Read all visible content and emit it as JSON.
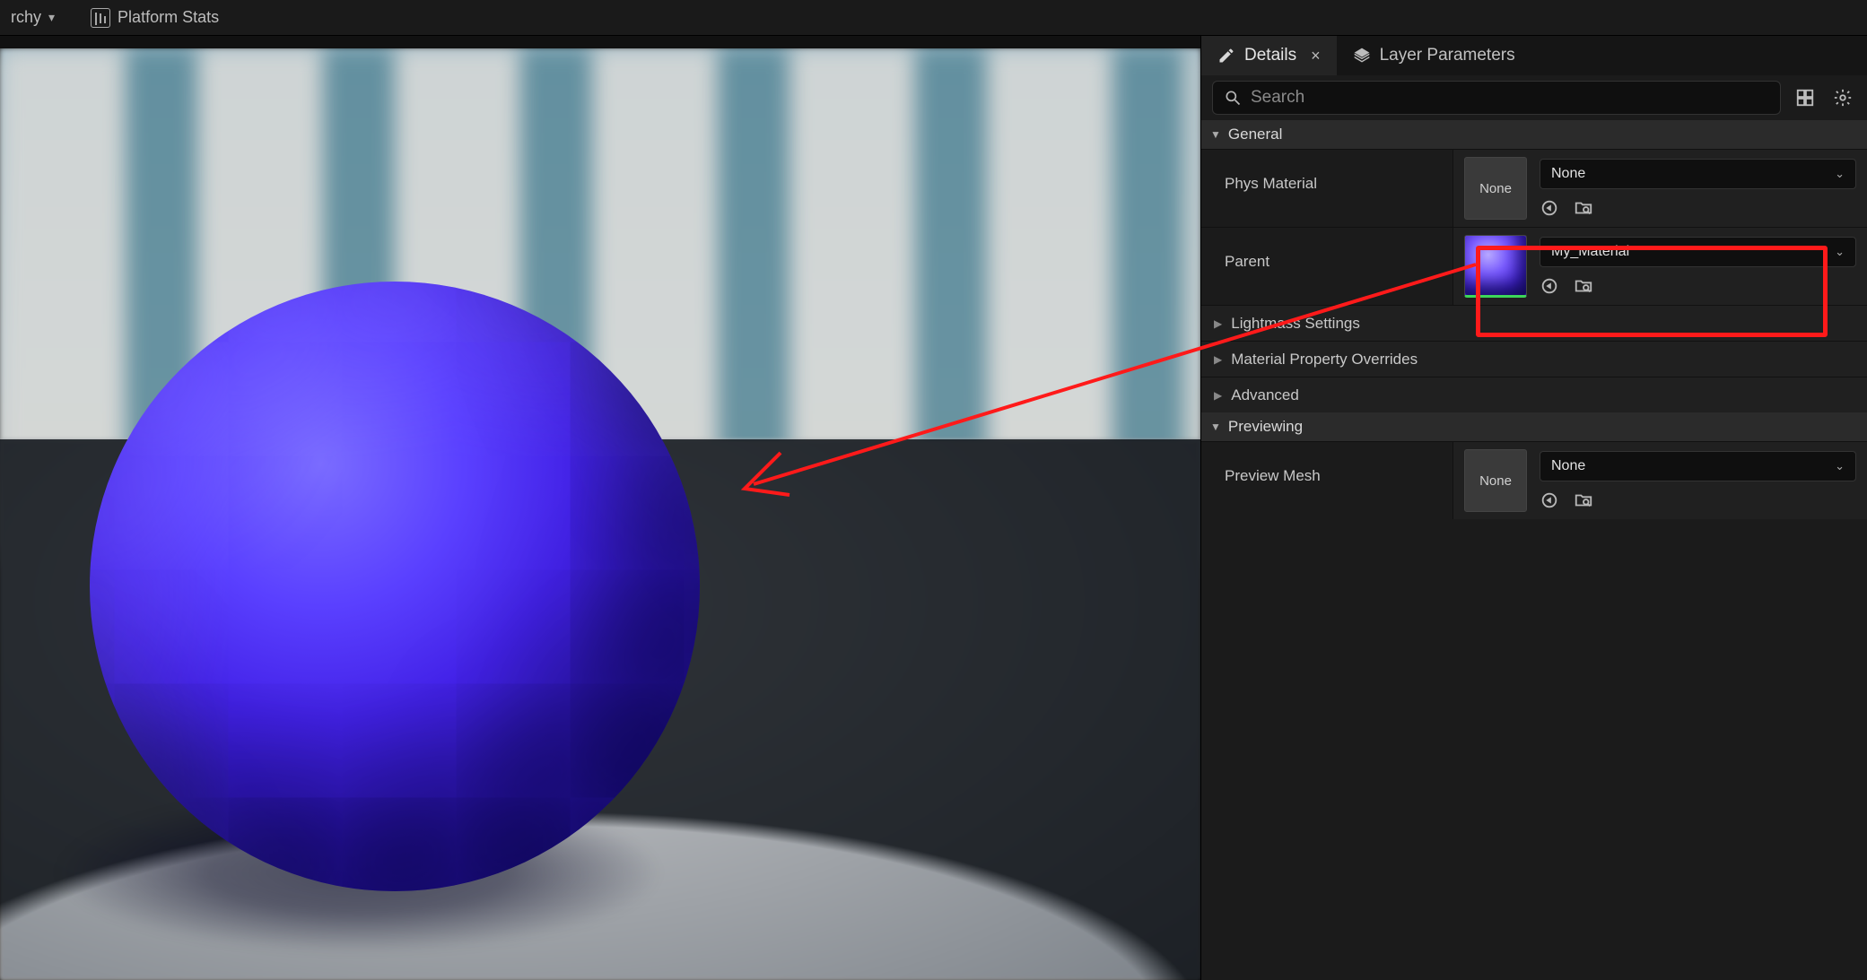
{
  "topstrip": {
    "hierarchy_fragment": "rchy",
    "platform_stats": "Platform Stats"
  },
  "tabs": {
    "details": "Details",
    "layer_params": "Layer Parameters"
  },
  "search": {
    "placeholder": "Search"
  },
  "sections": {
    "general": "General",
    "lightmass": "Lightmass Settings",
    "overrides": "Material Property Overrides",
    "advanced": "Advanced",
    "previewing": "Previewing"
  },
  "props": {
    "phys_material": {
      "label": "Phys Material",
      "thumb": "None",
      "value": "None"
    },
    "parent": {
      "label": "Parent",
      "value": "My_Material"
    },
    "preview_mesh": {
      "label": "Preview Mesh",
      "thumb": "None",
      "value": "None"
    }
  }
}
